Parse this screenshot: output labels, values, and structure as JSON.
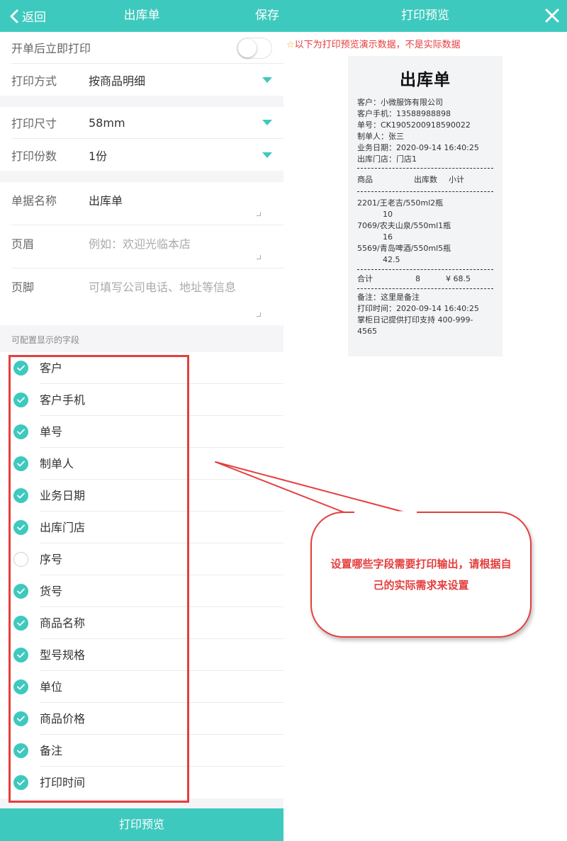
{
  "left": {
    "header": {
      "back_label": "返回",
      "title": "出库单",
      "save_label": "保存"
    },
    "settings": {
      "auto_print_label": "开单后立即打印",
      "auto_print_on": false,
      "print_mode_label": "打印方式",
      "print_mode_value": "按商品明细",
      "print_size_label": "打印尺寸",
      "print_size_value": "58mm",
      "print_copies_label": "打印份数",
      "print_copies_value": "1份"
    },
    "text_fields": {
      "doc_name_label": "单据名称",
      "doc_name_value": "出库单",
      "header_label": "页眉",
      "header_placeholder": "例如：欢迎光临本店",
      "footer_label": "页脚",
      "footer_placeholder": "可填写公司电话、地址等信息"
    },
    "fields_section_label": "可配置显示的字段",
    "fields": [
      {
        "label": "客户",
        "checked": true
      },
      {
        "label": "客户手机",
        "checked": true
      },
      {
        "label": "单号",
        "checked": true
      },
      {
        "label": "制单人",
        "checked": true
      },
      {
        "label": "业务日期",
        "checked": true
      },
      {
        "label": "出库门店",
        "checked": true
      },
      {
        "label": "序号",
        "checked": false
      },
      {
        "label": "货号",
        "checked": true
      },
      {
        "label": "商品名称",
        "checked": true
      },
      {
        "label": "型号规格",
        "checked": true
      },
      {
        "label": "单位",
        "checked": true
      },
      {
        "label": "商品价格",
        "checked": true
      },
      {
        "label": "备注",
        "checked": true
      },
      {
        "label": "打印时间",
        "checked": true
      }
    ],
    "preview_button_label": "打印预览"
  },
  "right": {
    "header": {
      "title": "打印预览"
    },
    "notice_star": "☆",
    "notice_text": "以下为打印预览演示数据，不是实际数据",
    "receipt": {
      "title": "出库单",
      "customer": "客户：小微服饰有限公司",
      "phone": "客户手机：13588988898",
      "order_no": "单号：CK1905200918590022",
      "creator": "制单人：张三",
      "biz_date": "业务日期：2020-09-14 16:40:25",
      "store": "出库门店：门店1",
      "col_goods": "商品",
      "col_qty": "出库数",
      "col_subtotal": "小计",
      "items": [
        {
          "name": "2201/王老吉/550ml2瓶",
          "value": "10"
        },
        {
          "name": "7069/农夫山泉/550ml1瓶",
          "value": "16"
        },
        {
          "name": "5569/青岛啤酒/550ml5瓶",
          "value": "42.5"
        }
      ],
      "total_label": "合计",
      "total_qty": "8",
      "total_amount": "¥ 68.5",
      "remark": "备注：这里是备注",
      "print_time": "打印时间：2020-09-14 16:40:25",
      "support_line1": "掌柜日记提供打印支持 400-999-",
      "support_line2": "4565"
    },
    "callout_text": "设置哪些字段需要打印输出，请根据自己的实际需求来设置"
  },
  "colors": {
    "accent": "#3ec9be",
    "annotation": "#e53e3e",
    "notice_star": "#f5a623"
  }
}
